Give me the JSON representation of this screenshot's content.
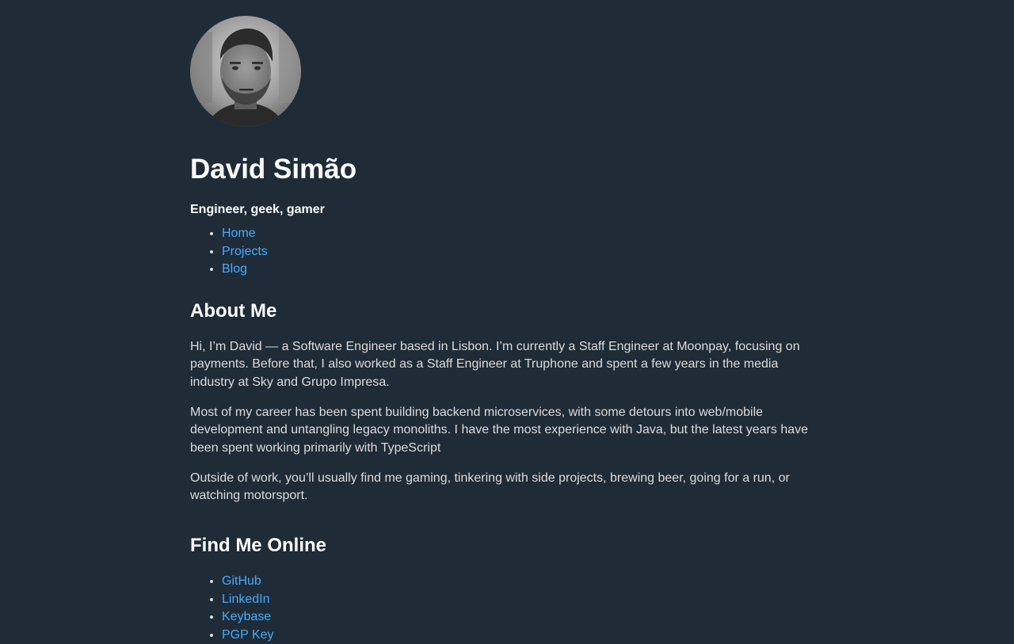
{
  "profile": {
    "name": "David Simão",
    "tagline": "Engineer, geek, gamer",
    "avatar_alt": "Photo of David Simão"
  },
  "nav": [
    {
      "label": "Home"
    },
    {
      "label": "Projects"
    },
    {
      "label": "Blog"
    }
  ],
  "about": {
    "heading": "About Me",
    "paragraphs": [
      "Hi, I’m David — a Software Engineer based in Lisbon. I’m currently a Staff Engineer at Moonpay, focusing on payments. Before that, I also worked as a Staff Engineer at Truphone and spent a few years in the media industry at Sky and Grupo Impresa.",
      "Most of my career has been spent building backend microservices, with some detours into web/mobile development and untangling legacy monoliths. I have the most experience with Java, but the latest years have been spent working primarily with TypeScript",
      "Outside of work, you’ll usually find me gaming, tinkering with side projects, brewing beer, going for a run, or watching motorsport."
    ]
  },
  "find_me": {
    "heading": "Find Me Online",
    "links": [
      {
        "label": "GitHub"
      },
      {
        "label": "LinkedIn"
      },
      {
        "label": "Keybase"
      },
      {
        "label": "PGP Key"
      }
    ]
  },
  "colors": {
    "background": "#202b38",
    "text": "#dbdbdb",
    "heading": "#ffffff",
    "link": "#41adff"
  }
}
